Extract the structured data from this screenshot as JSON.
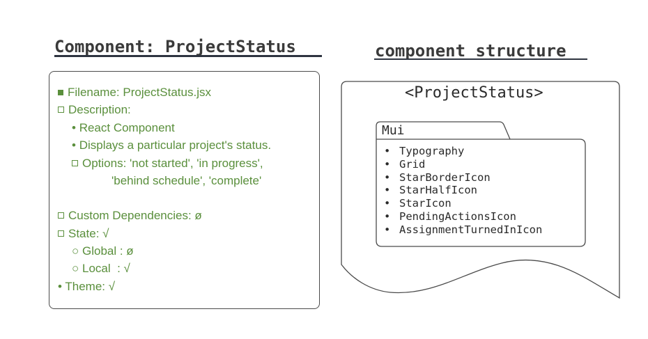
{
  "left": {
    "title": "Component: ProjectStatus",
    "filename": "Filename: ProjectStatus.jsx",
    "description_label": "Description:",
    "description_items": [
      "React Component",
      "Displays a particular project's status."
    ],
    "options_line1": "Options: 'not started', 'in progress',",
    "options_line2": "'behind schedule', 'complete'",
    "custom_dependencies": "Custom Dependencies: ø",
    "state": "State: √",
    "global": "Global : ø",
    "local": "Local  : √",
    "theme": "Theme: √"
  },
  "right": {
    "title": "component structure",
    "component_tag": "<ProjectStatus>",
    "folder_label": "Mui",
    "mui_items": [
      "Typography",
      "Grid",
      "StarBorderIcon",
      "StarHalfIcon",
      "StarIcon",
      "PendingActionsIcon",
      "AssignmentTurnedInIcon"
    ]
  },
  "colors": {
    "green_text": "#5a8f3c",
    "dark_text": "#3a3a3a",
    "border": "#4a4a4a"
  }
}
